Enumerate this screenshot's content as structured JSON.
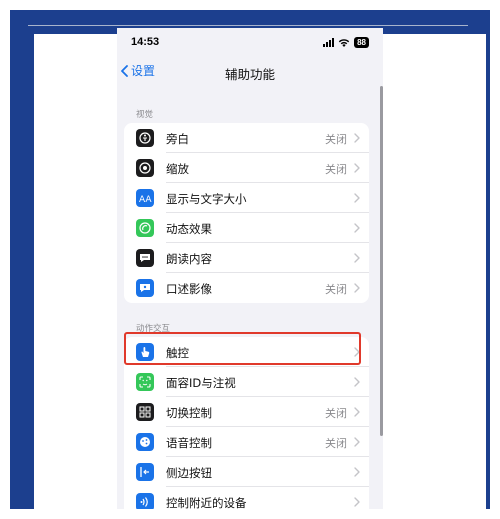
{
  "status": {
    "time": "14:53",
    "battery": "88"
  },
  "nav": {
    "back_label": "设置",
    "title": "辅助功能"
  },
  "sections": [
    {
      "header": "视觉",
      "items": [
        {
          "label": "旁白",
          "value": "关闭",
          "icon": "voiceover-icon",
          "color": "#1c1c1e"
        },
        {
          "label": "缩放",
          "value": "关闭",
          "icon": "zoom-icon",
          "color": "#1c1c1e"
        },
        {
          "label": "显示与文字大小",
          "value": "",
          "icon": "text-size-icon",
          "color": "#1a73e8"
        },
        {
          "label": "动态效果",
          "value": "",
          "icon": "motion-icon",
          "color": "#34c759"
        },
        {
          "label": "朗读内容",
          "value": "",
          "icon": "speech-bubble-icon",
          "color": "#1c1c1e"
        },
        {
          "label": "口述影像",
          "value": "关闭",
          "icon": "audio-description-icon",
          "color": "#1a73e8"
        }
      ]
    },
    {
      "header": "动作交互",
      "items": [
        {
          "label": "触控",
          "value": "",
          "icon": "hand-tap-icon",
          "color": "#1a73e8"
        },
        {
          "label": "面容ID与注视",
          "value": "",
          "icon": "face-id-icon",
          "color": "#34c759"
        },
        {
          "label": "切换控制",
          "value": "关闭",
          "icon": "switch-control-icon",
          "color": "#1c1c1e"
        },
        {
          "label": "语音控制",
          "value": "关闭",
          "icon": "voice-control-icon",
          "color": "#1a73e8"
        },
        {
          "label": "侧边按钮",
          "value": "",
          "icon": "side-button-icon",
          "color": "#1a73e8"
        },
        {
          "label": "控制附近的设备",
          "value": "",
          "icon": "nearby-devices-icon",
          "color": "#1a73e8"
        }
      ]
    }
  ],
  "highlight_color": "#e0392b",
  "frame_color": "#1c3f8e"
}
